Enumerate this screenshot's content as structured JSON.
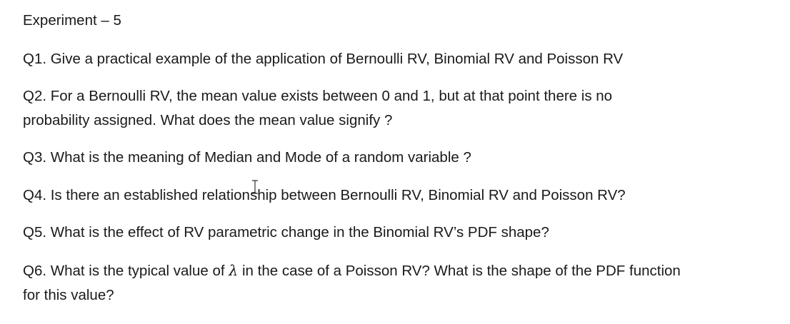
{
  "document": {
    "title": "Experiment – 5",
    "questions": [
      {
        "lines": [
          "Q1. Give a practical example of the application of Bernoulli RV, Binomial RV and Poisson RV"
        ]
      },
      {
        "lines": [
          "Q2. For a Bernoulli RV, the mean value exists between 0 and 1, but at that point there is no",
          "probability assigned. What does the mean value signify ?"
        ]
      },
      {
        "lines": [
          "Q3. What is the meaning of Median and Mode of a random variable ?"
        ]
      },
      {
        "lines": [
          "Q4. Is there an established relationship between Bernoulli RV, Binomial RV and Poisson RV?"
        ]
      },
      {
        "lines": [
          "Q5. What is the effect of RV parametric change in the Binomial RV’s PDF shape?"
        ]
      },
      {
        "line1_before": "Q6. What is the typical value of ",
        "line1_symbol": "λ",
        "line1_after": " in the case of a Poisson RV? What is the shape of the PDF function",
        "line2": "for this value?"
      }
    ]
  },
  "cursor": {
    "icon": "text-cursor-icon"
  }
}
